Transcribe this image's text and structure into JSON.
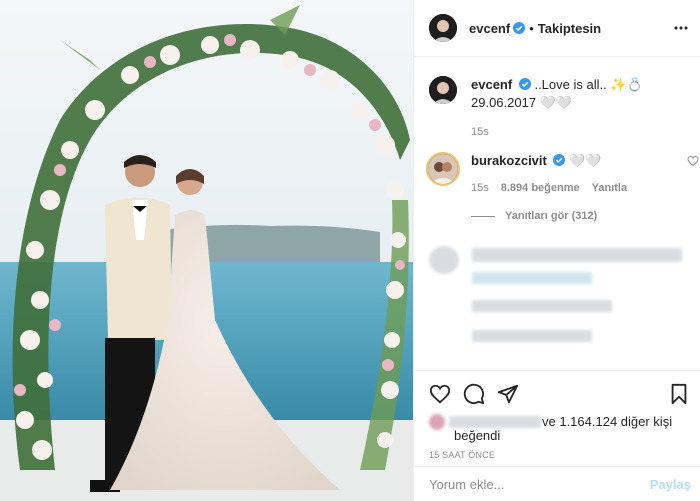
{
  "post": {
    "username": "evcenf",
    "follow_status": "Takiptesin",
    "separator": "•",
    "caption_text": "..Love is all.. ✨💍 29.06.2017 🤍🤍",
    "caption_time": "15s"
  },
  "comment": {
    "username": "burakozcivit",
    "text": "🤍🤍",
    "time": "15s",
    "likes": "8.894 beğenme",
    "reply_label": "Yanıtla",
    "view_replies": "Yanıtları gör (312)"
  },
  "likes": {
    "count_text": "ve 1.164.124 diğer kişi",
    "liked_label": "beğendi"
  },
  "timestamp": "15 SAAT ÖNCE",
  "add_comment": {
    "placeholder": "Yorum ekle...",
    "post_label": "Paylaş"
  },
  "colors": {
    "verified": "#3897f0",
    "link": "#b2dffc",
    "muted": "#8e8e8e",
    "text": "#262626"
  },
  "icons": [
    "more-icon",
    "verified-icon",
    "heart-icon",
    "comment-icon",
    "share-icon",
    "bookmark-icon",
    "like-small-icon"
  ]
}
